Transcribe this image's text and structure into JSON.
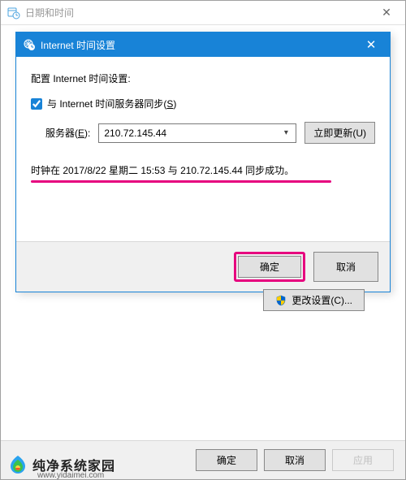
{
  "outer": {
    "title": "日期和时间",
    "change_settings_label": "更改设置(C)...",
    "footer": {
      "ok": "确定",
      "cancel": "取消",
      "apply": "应用"
    }
  },
  "inner": {
    "title": "Internet 时间设置",
    "config_label": "配置 Internet 时间设置:",
    "sync_checkbox_label_pre": "与 Internet 时间服务器同步(",
    "sync_checkbox_hotkey": "S",
    "sync_checkbox_label_post": ")",
    "sync_checked": true,
    "server_label_pre": "服务器(",
    "server_hotkey": "E",
    "server_label_post": "):",
    "server_value": "210.72.145.44",
    "update_now_label": "立即更新(U)",
    "status_text": "时钟在 2017/8/22 星期二 15:53 与 210.72.145.44 同步成功。",
    "footer": {
      "ok": "确定",
      "cancel": "取消"
    }
  },
  "watermark": {
    "text": "纯净系统家园",
    "url": "www.yidaimei.com"
  }
}
